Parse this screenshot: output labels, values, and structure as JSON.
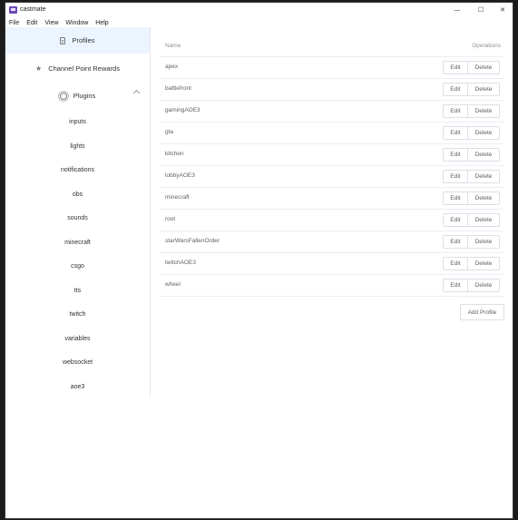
{
  "window": {
    "title": "castmate"
  },
  "menu": [
    "File",
    "Edit",
    "View",
    "Window",
    "Help"
  ],
  "controls": {
    "minimize": "—",
    "maximize": "☐",
    "close": "✕"
  },
  "sidebar": {
    "profiles_label": "Profiles",
    "rewards_label": "Channel Point Rewards",
    "plugins_label": "Plugins",
    "plugins": [
      "inputs",
      "lights",
      "notifications",
      "obs",
      "sounds",
      "minecraft",
      "csgo",
      "tts",
      "twitch",
      "variables",
      "websocket",
      "aoe3"
    ]
  },
  "table": {
    "col_name": "Name",
    "col_ops": "Operations",
    "edit_label": "Edit",
    "delete_label": "Delete",
    "rows": [
      "apex",
      "battlefront",
      "gamingAOE3",
      "gta",
      "kitchen",
      "lobbyAOE3",
      "minecraft",
      "root",
      "starWarsFallenOrder",
      "twitchAOE3",
      "wheel"
    ]
  },
  "add_profile_label": "Add Profile",
  "colors": {
    "active_bg": "#ecf5ff",
    "border": "#ebeef5"
  }
}
